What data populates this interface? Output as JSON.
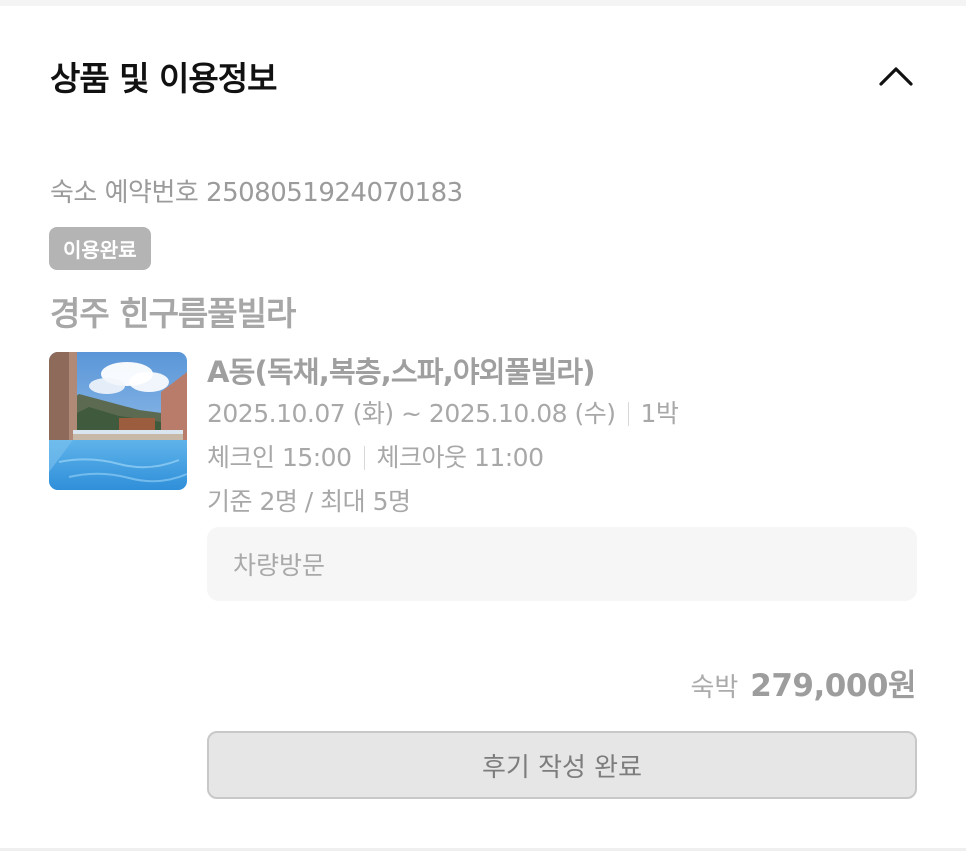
{
  "section": {
    "title": "상품 및 이용정보",
    "toggle_icon": "chevron-up-icon"
  },
  "reservation": {
    "label_number": "숙소 예약번호 2508051924070183",
    "status": "이용완료",
    "property_name": "경주 힌구름풀빌라"
  },
  "room": {
    "image_icon": "room-photo",
    "name": "A동(독채,복층,스파,야외풀빌라)",
    "dates": "2025.10.07 (화) ~ 2025.10.08 (수)",
    "nights": "1박",
    "checkin": "체크인 15:00",
    "checkout": "체크아웃 11:00",
    "capacity": "기준 2명 / 최대 5명"
  },
  "visit_method": "차량방문",
  "price": {
    "label": "숙박",
    "value": "279,000원"
  },
  "review_button": {
    "label": "후기 작성 완료"
  }
}
